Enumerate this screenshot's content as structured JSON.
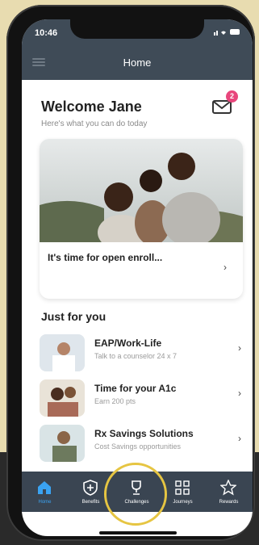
{
  "status": {
    "time": "10:46"
  },
  "header": {
    "title": "Home",
    "notifications": "2"
  },
  "welcome": {
    "title": "Welcome Jane",
    "subtitle": "Here's what you can do today"
  },
  "banner": {
    "title": "It's time for open enroll...",
    "chevron": "›"
  },
  "section": {
    "title": "Just for you"
  },
  "items": [
    {
      "title": "EAP/Work-Life",
      "subtitle": "Talk to a counselor 24 x 7",
      "chevron": "›"
    },
    {
      "title": "Time for your A1c",
      "subtitle": "Earn 200 pts",
      "chevron": "›"
    },
    {
      "title": "Rx Savings Solutions",
      "subtitle": "Cost Savings opportunities",
      "chevron": "›"
    }
  ],
  "tabs": [
    {
      "label": "Home",
      "icon": "home-icon",
      "active": true
    },
    {
      "label": "Benefits",
      "icon": "shield-plus-icon"
    },
    {
      "label": "Challenges",
      "icon": "trophy-icon"
    },
    {
      "label": "Journeys",
      "icon": "grid-icon"
    },
    {
      "label": "Rewards",
      "icon": "star-icon"
    }
  ],
  "colors": {
    "accent": "#3aa3f2",
    "header": "#3f4b57",
    "badge": "#e8467c",
    "highlight": "#e6c542"
  }
}
